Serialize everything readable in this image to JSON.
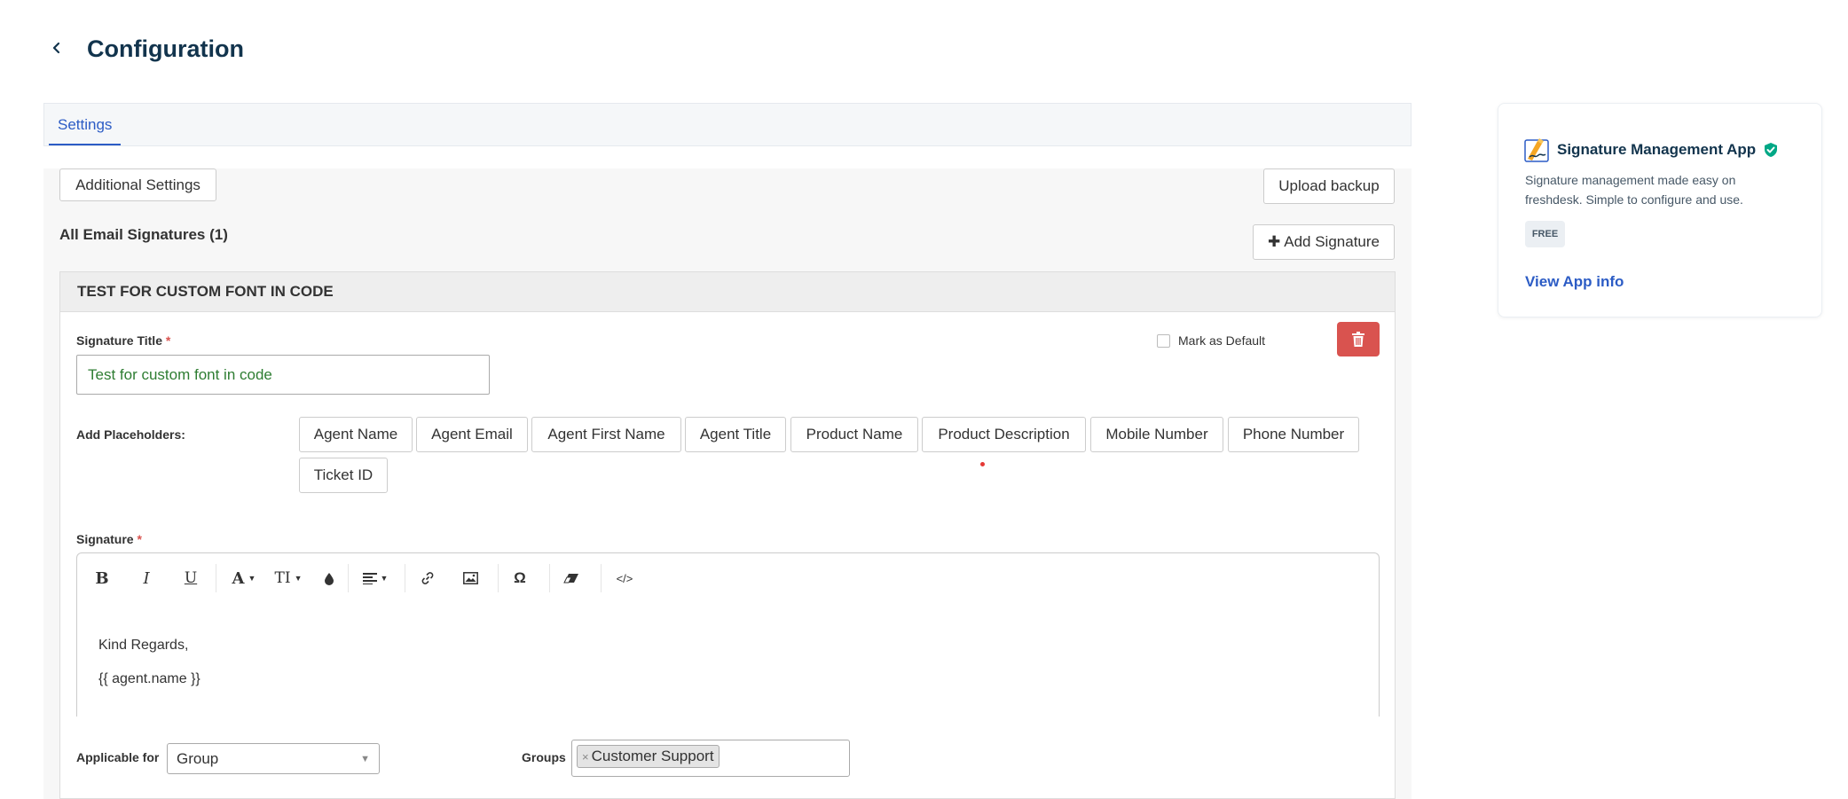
{
  "header": {
    "title": "Configuration"
  },
  "tabs": [
    {
      "label": "Settings",
      "active": true
    }
  ],
  "toolbar": {
    "additional_settings": "Additional Settings",
    "upload_backup": "Upload backup",
    "add_signature": "Add Signature"
  },
  "signatures": {
    "heading": "All Email Signatures (1)",
    "items": [
      {
        "header": "TEST FOR CUSTOM FONT IN CODE",
        "title_label": "Signature Title",
        "required_mark": "*",
        "title_value": "Test for custom font in code",
        "mark_default_label": "Mark as Default",
        "mark_default_checked": false,
        "placeholders_label": "Add Placeholders:",
        "placeholders": [
          "Agent Name",
          "Agent Email",
          "Agent First Name",
          "Agent Title",
          "Product Name",
          "Product Description",
          "Mobile Number",
          "Phone Number",
          "Ticket ID"
        ],
        "signature_label": "Signature",
        "editor_tools": [
          "bold-icon",
          "italic-icon",
          "underline-icon",
          "font-color-icon",
          "font-size-icon",
          "fill-color-icon",
          "align-icon",
          "link-icon",
          "image-icon",
          "special-char-icon",
          "clear-format-icon",
          "code-view-icon"
        ],
        "editor_lines": [
          "Kind Regards,",
          "{{ agent.name }}"
        ],
        "applicable_label": "Applicable for",
        "applicable_value": "Group",
        "groups_label": "Groups",
        "groups_tags": [
          "Customer Support"
        ]
      }
    ]
  },
  "app_card": {
    "name": "Signature Management App",
    "description": "Signature management made easy on freshdesk. Simple to configure and use.",
    "badge": "FREE",
    "link": "View App info"
  },
  "colors": {
    "primary": "#2c5cc5",
    "title": "#12344d",
    "danger": "#d9534f",
    "verified": "#00a886",
    "input_text": "#2e7d32"
  }
}
